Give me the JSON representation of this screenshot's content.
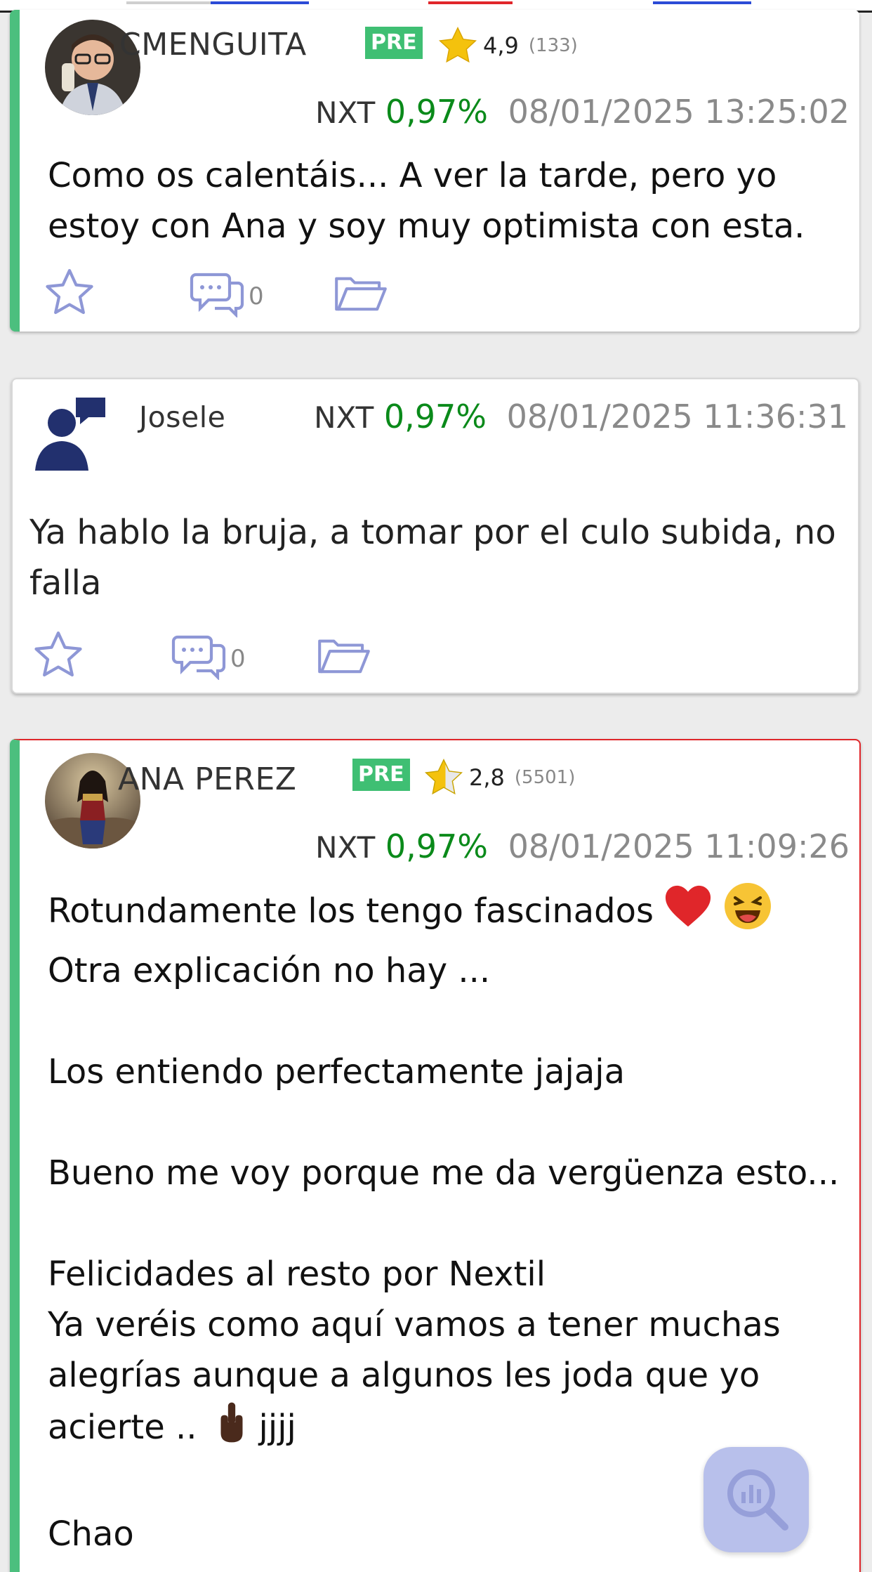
{
  "posts": [
    {
      "user": "CMENGUITA",
      "badge": "PRE",
      "rating": "4,9",
      "rating_count": "(133)",
      "ticker": "NXT",
      "change": "0,97%",
      "datetime": "08/01/2025 13:25:02",
      "body": "Como os calentáis... A ver la tarde, pero yo\nestoy con Ana y soy muy optimista con esta.",
      "comments": "0"
    },
    {
      "user": "Josele",
      "ticker": "NXT",
      "change": "0,97%",
      "datetime": "08/01/2025 11:36:31",
      "body": "Ya hablo la bruja, a tomar por el culo subida, no\nfalla",
      "comments": "0"
    },
    {
      "user": "ANA PEREZ",
      "badge": "PRE",
      "rating": "2,8",
      "rating_count": "(5501)",
      "ticker": "NXT",
      "change": "0,97%",
      "datetime": "08/01/2025 11:09:26",
      "body_lines": [
        "Rotundamente los tengo fascinados",
        "Otra explicación no hay ...",
        "Los entiendo perfectamente jajaja",
        "Bueno me voy porque me da vergüenza esto...",
        "Felicidades al resto por Nextil",
        "Ya veréis como aquí vamos a tener muchas",
        "alegrías aunque a algunos les joda que yo",
        "acierte ..",
        "jjjj",
        "Chao"
      ]
    }
  ],
  "colors": {
    "accent": "#4cbf7e",
    "positive": "#0a8a1a",
    "flag_border": "#e0262a",
    "icon": "#8e97d6"
  },
  "icons": {
    "favorite": "star-outline-icon",
    "comments": "comment-bubble-icon",
    "folder": "folder-icon",
    "fab": "chart-search-icon"
  }
}
